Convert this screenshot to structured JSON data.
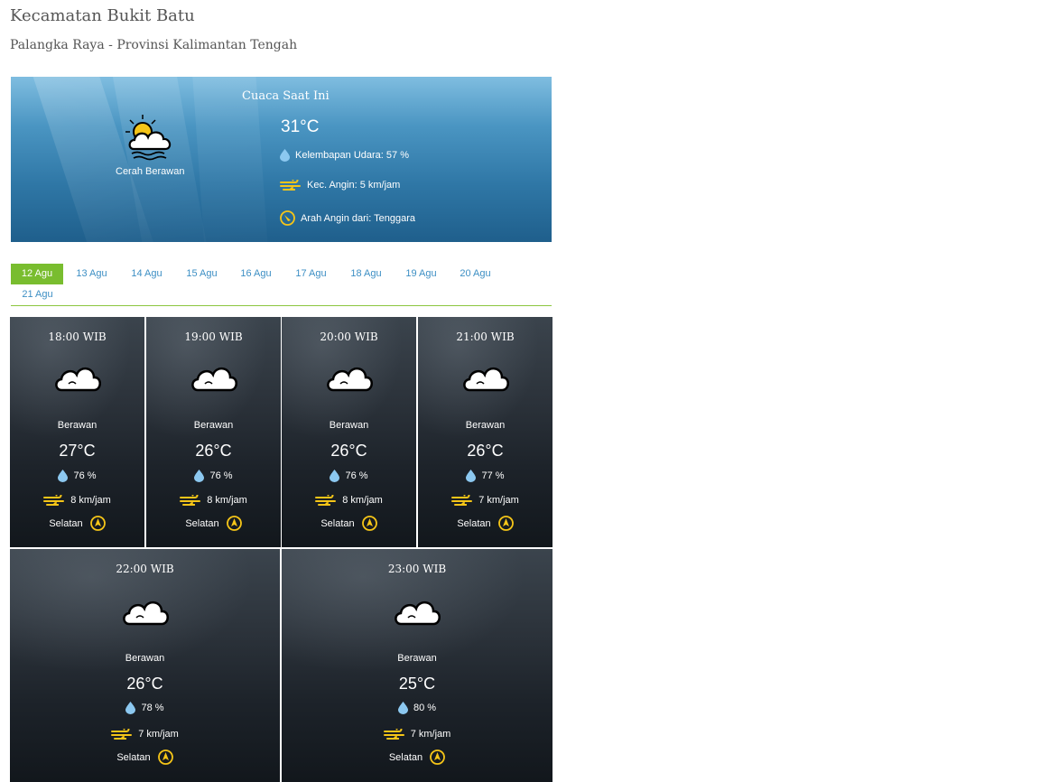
{
  "header": {
    "title": "Kecamatan Bukit Batu",
    "subtitle": "Palangka Raya - Provinsi Kalimantan Tengah"
  },
  "current": {
    "heading": "Cuaca Saat Ini",
    "temperature": "31°C",
    "condition": "Cerah Berawan",
    "icon": "partly-cloudy-sun-icon",
    "humidity": "Kelembapan Udara: 57 %",
    "wind_speed": "Kec. Angin: 5 km/jam",
    "wind_direction": "Arah Angin dari: Tenggara"
  },
  "tabs": [
    {
      "label": "12 Agu",
      "active": true
    },
    {
      "label": "13 Agu"
    },
    {
      "label": "14 Agu"
    },
    {
      "label": "15 Agu"
    },
    {
      "label": "16 Agu"
    },
    {
      "label": "17 Agu"
    },
    {
      "label": "18 Agu"
    },
    {
      "label": "19 Agu"
    },
    {
      "label": "20 Agu"
    },
    {
      "label": "21 Agu"
    }
  ],
  "forecast": [
    {
      "time": "18:00 WIB",
      "condition": "Berawan",
      "temp": "27°C",
      "humidity": "76 %",
      "wind": "8 km/jam",
      "direction": "Selatan"
    },
    {
      "time": "19:00 WIB",
      "condition": "Berawan",
      "temp": "26°C",
      "humidity": "76 %",
      "wind": "8 km/jam",
      "direction": "Selatan"
    },
    {
      "time": "20:00 WIB",
      "condition": "Berawan",
      "temp": "26°C",
      "humidity": "76 %",
      "wind": "8 km/jam",
      "direction": "Selatan"
    },
    {
      "time": "21:00 WIB",
      "condition": "Berawan",
      "temp": "26°C",
      "humidity": "77 %",
      "wind": "7 km/jam",
      "direction": "Selatan"
    },
    {
      "time": "22:00 WIB",
      "condition": "Berawan",
      "temp": "26°C",
      "humidity": "78 %",
      "wind": "7 km/jam",
      "direction": "Selatan"
    },
    {
      "time": "23:00 WIB",
      "condition": "Berawan",
      "temp": "25°C",
      "humidity": "80 %",
      "wind": "7 km/jam",
      "direction": "Selatan"
    }
  ],
  "colors": {
    "active_tab": "#79bd2f",
    "tab_text": "#3d8fc4",
    "icon_accent": "#f5c518",
    "drop": "#8cc8f0"
  }
}
